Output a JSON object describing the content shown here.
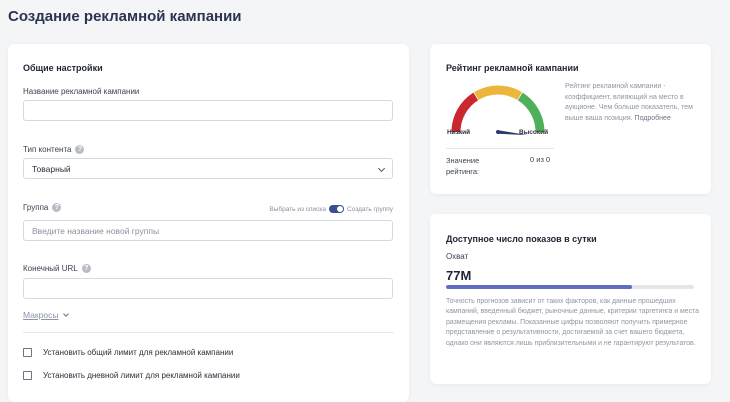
{
  "page": {
    "title": "Создание рекламной кампании"
  },
  "settings": {
    "title": "Общие настройки",
    "campaign_name": {
      "label": "Название рекламной кампании",
      "value": ""
    },
    "content_type": {
      "label": "Тип контента",
      "value": "Товарный"
    },
    "group": {
      "label": "Группа",
      "placeholder": "Введите название новой группы",
      "toggle_left": "Выбрать из списка",
      "toggle_right": "Создать группу"
    },
    "final_url": {
      "label": "Конечный URL",
      "value": ""
    },
    "macros_link": "Макросы",
    "checkboxes": [
      {
        "label": "Установить общий лимит для рекламной кампании",
        "checked": false
      },
      {
        "label": "Установить дневной лимит для рекламной кампании",
        "checked": false
      }
    ]
  },
  "rating": {
    "title": "Рейтинг рекламной кампании",
    "low_label": "Низкий",
    "high_label": "Высокий",
    "description": "Рейтинг рекламной кампании - коэффициент, влияющий на место в аукционе. Чем больше показатель, тем выше ваша позиция.",
    "more_link": "Подробнее",
    "value_label": "Значение рейтинга:",
    "value": "0 из 0",
    "score": 0,
    "gauge_colors": [
      "#c8282e",
      "#ecb53c",
      "#4faf5a"
    ]
  },
  "reach": {
    "title": "Доступное число показов в сутки",
    "label": "Охват",
    "value": "77M",
    "fill_fraction": 0.75,
    "bar_color": "#5f6dc3",
    "description": "Точность прогнозов зависит от таких факторов, как данные прошедших кампаний, введенный бюджет, рыночные данные, критерии таргетинга и места размещения рекламы. Показанные цифры позволяют получить примерное представление о результативности, достигаемой за счет вашего бюджета, однако они являются лишь приблизительными и не гарантируют результатов."
  }
}
